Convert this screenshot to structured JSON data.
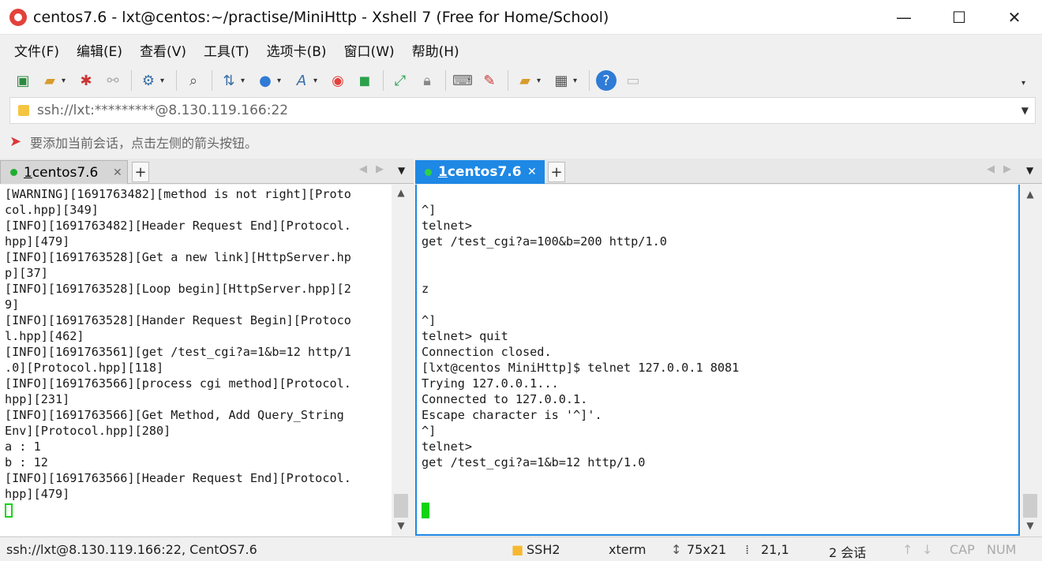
{
  "window": {
    "title": "centos7.6 - lxt@centos:~/practise/MiniHttp - Xshell 7 (Free for Home/School)",
    "minimize": "—",
    "maximize": "☐",
    "close": "✕"
  },
  "menu": [
    "文件(F)",
    "编辑(E)",
    "查看(V)",
    "工具(T)",
    "选项卡(B)",
    "窗口(W)",
    "帮助(H)"
  ],
  "toolbar": {
    "icons": [
      "new-session-icon",
      "open-folder-icon",
      "disconnect-icon",
      "reconnect-icon",
      "properties-icon",
      "find-icon",
      "transfer-icon",
      "globe-icon",
      "font-icon",
      "xshell-icon",
      "xftp-icon",
      "fullscreen-icon",
      "lock-icon",
      "keyboard-icon",
      "highlight-icon",
      "new-folder-icon",
      "layout-icon",
      "help-icon",
      "chat-icon"
    ],
    "more": "▾"
  },
  "address": {
    "value": "ssh://lxt:*********@8.130.119.166:22"
  },
  "hint": "要添加当前会话，点击左侧的箭头按钮。",
  "left_pane": {
    "tab_number": "1",
    "tab_label": " centos7.6",
    "close": "✕",
    "add": "+",
    "lines": [
      "[WARNING][1691763482][method is not right][Proto",
      "col.hpp][349]",
      "[INFO][1691763482][Header Request End][Protocol.",
      "hpp][479]",
      "[INFO][1691763528][Get a new link][HttpServer.hp",
      "p][37]",
      "[INFO][1691763528][Loop begin][HttpServer.hpp][2",
      "9]",
      "[INFO][1691763528][Hander Request Begin][Protoco",
      "l.hpp][462]",
      "[INFO][1691763561][get /test_cgi?a=1&b=12 http/1",
      ".0][Protocol.hpp][118]",
      "[INFO][1691763566][process cgi method][Protocol.",
      "hpp][231]",
      "[INFO][1691763566][Get Method, Add Query_String",
      "Env][Protocol.hpp][280]",
      "a : 1",
      "b : 12",
      "[INFO][1691763566][Header Request End][Protocol.",
      "hpp][479]"
    ]
  },
  "right_pane": {
    "tab_number": "1",
    "tab_label": " centos7.6",
    "close": "✕",
    "add": "+",
    "lines": [
      "",
      "^]",
      "telnet>",
      "get /test_cgi?a=100&b=200 http/1.0",
      "",
      "",
      "z",
      "",
      "^]",
      "telnet> quit",
      "Connection closed.",
      "[lxt@centos MiniHttp]$ telnet 127.0.0.1 8081",
      "Trying 127.0.0.1...",
      "Connected to 127.0.0.1.",
      "Escape character is '^]'.",
      "^]",
      "telnet>",
      "get /test_cgi?a=1&b=12 http/1.0",
      "",
      ""
    ]
  },
  "status": {
    "connection": "ssh://lxt@8.130.119.166:22, CentOS7.6",
    "protocol": "SSH2",
    "term": "xterm",
    "size": "75x21",
    "pos": "21,1",
    "sessions": "2 会话",
    "cap": "CAP",
    "num": "NUM"
  },
  "colors": {
    "active_tab": "#1e88e5",
    "cursor": "#12d412",
    "status_dot": "#1fae31"
  }
}
